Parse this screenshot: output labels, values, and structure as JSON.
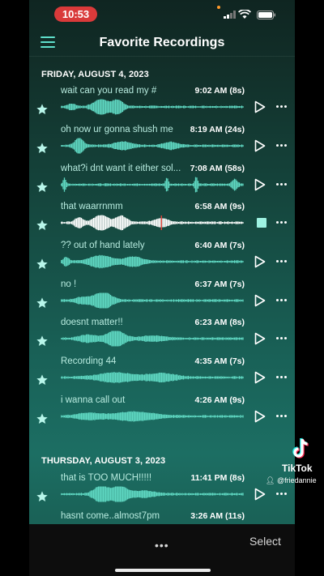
{
  "status_bar": {
    "time": "10:53"
  },
  "header": {
    "title": "Favorite Recordings"
  },
  "sections": [
    {
      "date": "FRIDAY, AUGUST 4, 2023",
      "items": [
        {
          "title": "wait can you read my #",
          "time": "9:02 AM",
          "duration": "(8s)",
          "meta": "9:02 AM (8s)",
          "state": "idle"
        },
        {
          "title": "oh now ur gonna shush me",
          "time": "8:19 AM",
          "duration": "(24s)",
          "meta": "8:19 AM (24s)",
          "state": "idle"
        },
        {
          "title": "what?i dnt want it either sol...",
          "time": "7:08 AM",
          "duration": "(58s)",
          "meta": "7:08 AM (58s)",
          "state": "idle"
        },
        {
          "title": "that waarrnmm",
          "time": "6:58 AM",
          "duration": "(9s)",
          "meta": "6:58 AM (9s)",
          "state": "playing"
        },
        {
          "title": "?? out of hand lately",
          "time": "6:40 AM",
          "duration": "(7s)",
          "meta": "6:40 AM (7s)",
          "state": "idle"
        },
        {
          "title": "no !",
          "time": "6:37 AM",
          "duration": "(7s)",
          "meta": "6:37 AM (7s)",
          "state": "idle"
        },
        {
          "title": "doesnt matter!!",
          "time": "6:23 AM",
          "duration": "(8s)",
          "meta": "6:23 AM (8s)",
          "state": "idle"
        },
        {
          "title": "Recording 44",
          "time": "4:35 AM",
          "duration": "(7s)",
          "meta": "4:35 AM (7s)",
          "state": "idle"
        },
        {
          "title": "i wanna call out",
          "time": "4:26 AM",
          "duration": "(9s)",
          "meta": "4:26 AM (9s)",
          "state": "idle"
        }
      ]
    },
    {
      "date": "THURSDAY, AUGUST 3, 2023",
      "items": [
        {
          "title": "that is TOO MUCH!!!!!",
          "time": "11:41 PM",
          "duration": "(8s)",
          "meta": "11:41 PM (8s)",
          "state": "idle"
        },
        {
          "title": "hasnt come..almost7pm",
          "time": "3:26 AM",
          "duration": "(11s)",
          "meta": "3:26 AM (11s)",
          "state": "idle"
        }
      ]
    }
  ],
  "bottom_bar": {
    "more_label": "•••",
    "select_label": "Select"
  },
  "watermark": {
    "brand": "TikTok",
    "user": "@friedannie"
  },
  "colors": {
    "accent": "#5fe0cc",
    "record_time_pill": "#d93a3a",
    "playing_wave": "#ffffff",
    "playhead": "#e0443a"
  },
  "icons": [
    "menu-icon",
    "star-icon",
    "play-icon",
    "stop-icon",
    "more-icon",
    "signal-icon",
    "wifi-icon",
    "battery-icon",
    "tiktok-logo"
  ]
}
